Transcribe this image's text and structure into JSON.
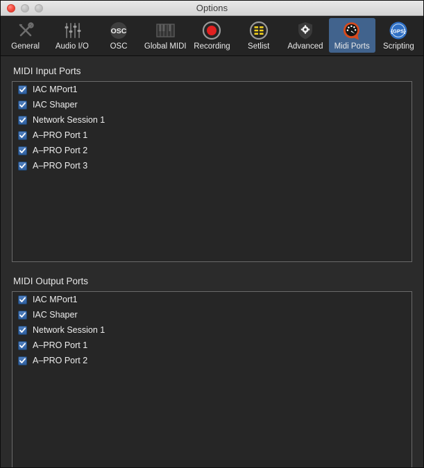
{
  "window": {
    "title": "Options",
    "controls": [
      {
        "name": "close-button",
        "icon": "close-dot",
        "state": "active"
      },
      {
        "name": "minimize-button",
        "icon": "minimize-dot",
        "state": "disabled"
      },
      {
        "name": "maximize-button",
        "icon": "maximize-dot",
        "state": "disabled"
      }
    ]
  },
  "toolbar": {
    "selected": "Midi Ports",
    "items": [
      {
        "label": "General",
        "icon": "wrench-screwdriver-icon",
        "selected": false
      },
      {
        "label": "Audio I/O",
        "icon": "sliders-icon",
        "selected": false
      },
      {
        "label": "OSC",
        "icon": "osc-circle-icon",
        "selected": false
      },
      {
        "label": "Global MIDI",
        "icon": "piano-keyboard-icon",
        "selected": false
      },
      {
        "label": "Recording",
        "icon": "record-circle-icon",
        "selected": false
      },
      {
        "label": "Setlist",
        "icon": "setlist-grid-icon",
        "selected": false
      },
      {
        "label": "Advanced",
        "icon": "shield-gear-icon",
        "selected": false
      },
      {
        "label": "Midi Ports",
        "icon": "midi-gauge-icon",
        "selected": true
      },
      {
        "label": "Scripting",
        "icon": "gps-circle-icon",
        "selected": false
      }
    ]
  },
  "sections": [
    {
      "id": "midi-input-ports",
      "title": "MIDI Input Ports",
      "ports": [
        {
          "label": "IAC MPort1",
          "checked": true
        },
        {
          "label": "IAC Shaper",
          "checked": true
        },
        {
          "label": "Network Session 1",
          "checked": true
        },
        {
          "label": "A–PRO Port 1",
          "checked": true
        },
        {
          "label": "A–PRO Port 2",
          "checked": true
        },
        {
          "label": "A–PRO Port 3",
          "checked": true
        }
      ]
    },
    {
      "id": "midi-output-ports",
      "title": "MIDI Output Ports",
      "ports": [
        {
          "label": "IAC MPort1",
          "checked": true
        },
        {
          "label": "IAC Shaper",
          "checked": true
        },
        {
          "label": "Network Session 1",
          "checked": true
        },
        {
          "label": "A–PRO Port 1",
          "checked": true
        },
        {
          "label": "A–PRO Port 2",
          "checked": true
        }
      ]
    }
  ],
  "colors": {
    "window_bg": "#2b2b2b",
    "toolbar_bg": "#242424",
    "selection_blue": "#41638d",
    "checkbox_blue": "#2f5f9f",
    "text": "#ededed",
    "listbox_border": "#6b6b6b",
    "record_red": "#e02020",
    "setlist_yellow": "#f2d01e",
    "gps_blue": "#2f6fc4",
    "midi_orange": "#d64a1e"
  }
}
